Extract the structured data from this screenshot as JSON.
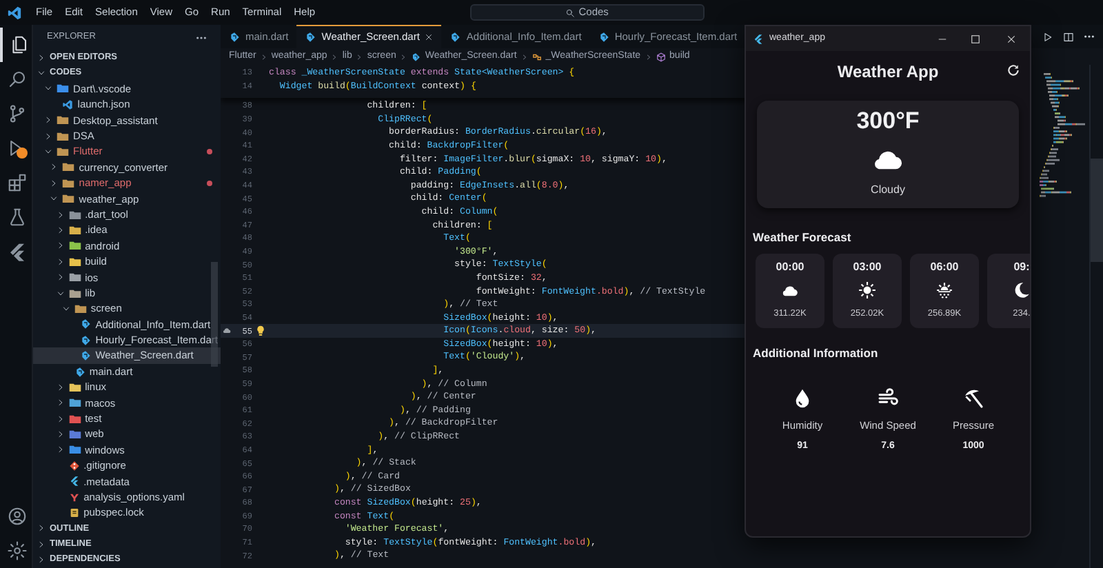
{
  "title_bar": {
    "menus": [
      "File",
      "Edit",
      "Selection",
      "View",
      "Go",
      "Run",
      "Terminal",
      "Help"
    ],
    "search": "Codes"
  },
  "sidebar": {
    "title": "EXPLORER",
    "sections": [
      {
        "title": "OPEN EDITORS",
        "expanded": false
      },
      {
        "title": "CODES",
        "expanded": true,
        "items": [
          {
            "label": "Dart\\.vscode",
            "kind": "folder",
            "color": "#3b8eea",
            "expanded": true,
            "selected": false,
            "modified": false,
            "children": [
              {
                "label": "launch.json",
                "kind": "json",
                "selected": false,
                "modified": false
              }
            ]
          },
          {
            "label": "Desktop_assistant",
            "kind": "folder",
            "color": "#c09553",
            "expanded": false,
            "selected": false,
            "modified": false
          },
          {
            "label": "DSA",
            "kind": "folder",
            "color": "#c09553",
            "expanded": false,
            "selected": false,
            "modified": false
          },
          {
            "label": "Flutter",
            "kind": "folder",
            "color": "#c09553",
            "expanded": true,
            "selected": false,
            "modified": true,
            "children": [
              {
                "label": "currency_converter",
                "kind": "folder",
                "color": "#c09553",
                "expanded": false,
                "selected": false,
                "modified": false
              },
              {
                "label": "namer_app",
                "kind": "folder",
                "color": "#c09553",
                "expanded": false,
                "selected": false,
                "modified": true
              },
              {
                "label": "weather_app",
                "kind": "folder",
                "color": "#c09553",
                "expanded": true,
                "selected": false,
                "modified": false,
                "children": [
                  {
                    "label": ".dart_tool",
                    "kind": "folder",
                    "color": "#8a9199",
                    "expanded": false,
                    "selected": false,
                    "modified": false
                  },
                  {
                    "label": ".idea",
                    "kind": "folder",
                    "color": "#d8b04a",
                    "expanded": false,
                    "selected": false,
                    "modified": false
                  },
                  {
                    "label": "android",
                    "kind": "folder",
                    "color": "#8bc34a",
                    "expanded": false,
                    "selected": false,
                    "modified": false
                  },
                  {
                    "label": "build",
                    "kind": "folder",
                    "color": "#e6c04a",
                    "expanded": false,
                    "selected": false,
                    "modified": false
                  },
                  {
                    "label": "ios",
                    "kind": "folder",
                    "color": "#9aa0a6",
                    "expanded": false,
                    "selected": false,
                    "modified": false
                  },
                  {
                    "label": "lib",
                    "kind": "folder",
                    "color": "#a9a090",
                    "expanded": true,
                    "selected": false,
                    "modified": false,
                    "children": [
                      {
                        "label": "screen",
                        "kind": "folder",
                        "color": "#c09553",
                        "expanded": true,
                        "selected": false,
                        "modified": false,
                        "children": [
                          {
                            "label": "Additional_Info_Item.dart",
                            "kind": "dart",
                            "selected": false,
                            "modified": false
                          },
                          {
                            "label": "Hourly_Forecast_Item.dart",
                            "kind": "dart",
                            "selected": false,
                            "modified": false
                          },
                          {
                            "label": "Weather_Screen.dart",
                            "kind": "dart",
                            "selected": true,
                            "modified": false
                          }
                        ]
                      },
                      {
                        "label": "main.dart",
                        "kind": "dart",
                        "selected": false,
                        "modified": false
                      }
                    ]
                  },
                  {
                    "label": "linux",
                    "kind": "folder",
                    "color": "#e5c35a",
                    "expanded": false,
                    "selected": false,
                    "modified": false
                  },
                  {
                    "label": "macos",
                    "kind": "folder",
                    "color": "#4fa3d8",
                    "expanded": false,
                    "selected": false,
                    "modified": false
                  },
                  {
                    "label": "test",
                    "kind": "folder",
                    "color": "#e05252",
                    "expanded": false,
                    "selected": false,
                    "modified": false
                  },
                  {
                    "label": "web",
                    "kind": "folder",
                    "color": "#5b7bd6",
                    "expanded": false,
                    "selected": false,
                    "modified": false
                  },
                  {
                    "label": "windows",
                    "kind": "folder",
                    "color": "#3a8ee6",
                    "expanded": false,
                    "selected": false,
                    "modified": false
                  },
                  {
                    "label": ".gitignore",
                    "kind": "git",
                    "selected": false,
                    "modified": false
                  },
                  {
                    "label": ".metadata",
                    "kind": "meta",
                    "selected": false,
                    "modified": false
                  },
                  {
                    "label": "analysis_options.yaml",
                    "kind": "yaml",
                    "selected": false,
                    "modified": false
                  },
                  {
                    "label": "pubspec.lock",
                    "kind": "lock",
                    "selected": false,
                    "modified": false
                  }
                ]
              }
            ]
          }
        ]
      },
      {
        "title": "OUTLINE",
        "expanded": false
      },
      {
        "title": "TIMELINE",
        "expanded": false
      },
      {
        "title": "DEPENDENCIES",
        "expanded": false
      }
    ]
  },
  "editor": {
    "tabs": [
      {
        "label": "main.dart",
        "selected": false
      },
      {
        "label": "Weather_Screen.dart",
        "selected": true
      },
      {
        "label": "Additional_Info_Item.dart",
        "selected": false
      },
      {
        "label": "Hourly_Forecast_Item.dart",
        "selected": false
      }
    ],
    "breadcrumb": [
      {
        "text": "Flutter",
        "kind": "plain"
      },
      {
        "text": "weather_app",
        "kind": "plain"
      },
      {
        "text": "lib",
        "kind": "plain"
      },
      {
        "text": "screen",
        "kind": "plain"
      },
      {
        "text": "Weather_Screen.dart",
        "kind": "dart"
      },
      {
        "text": "_WeatherScreenState",
        "kind": "class"
      },
      {
        "text": "build",
        "kind": "method"
      }
    ],
    "sticky_lines": [
      {
        "number": "13",
        "tokens": [
          {
            "kind": "kw",
            "text": "class "
          },
          {
            "kind": "type",
            "text": "_WeatherScreenState "
          },
          {
            "kind": "kw",
            "text": "extends "
          },
          {
            "kind": "type",
            "text": "State<WeatherScreen> "
          },
          {
            "kind": "br",
            "text": "{"
          }
        ]
      },
      {
        "number": "14",
        "tokens": [
          {
            "kind": "type",
            "text": "  Widget "
          },
          {
            "kind": "fn",
            "text": "build"
          },
          {
            "kind": "br",
            "text": "("
          },
          {
            "kind": "type",
            "text": "BuildContext "
          },
          {
            "kind": "p",
            "text": "context"
          },
          {
            "kind": "br",
            "text": ") {"
          }
        ]
      }
    ],
    "lines": [
      {
        "number": "38",
        "current": false,
        "tokens": [
          {
            "kind": "p",
            "text": "                  children: "
          },
          {
            "kind": "br",
            "text": "["
          }
        ]
      },
      {
        "number": "39",
        "current": false,
        "tokens": [
          {
            "kind": "type",
            "text": "                    ClipRRect"
          },
          {
            "kind": "br",
            "text": "("
          }
        ]
      },
      {
        "number": "40",
        "current": false,
        "tokens": [
          {
            "kind": "p",
            "text": "                      borderRadius: "
          },
          {
            "kind": "type",
            "text": "BorderRadius"
          },
          {
            "kind": "p",
            "text": "."
          },
          {
            "kind": "fn",
            "text": "circular"
          },
          {
            "kind": "br",
            "text": "("
          },
          {
            "kind": "num",
            "text": "16"
          },
          {
            "kind": "br",
            "text": ")"
          },
          {
            "kind": "p",
            "text": ","
          }
        ]
      },
      {
        "number": "41",
        "current": false,
        "tokens": [
          {
            "kind": "p",
            "text": "                      child: "
          },
          {
            "kind": "type",
            "text": "BackdropFilter"
          },
          {
            "kind": "br",
            "text": "("
          }
        ]
      },
      {
        "number": "42",
        "current": false,
        "tokens": [
          {
            "kind": "p",
            "text": "                        filter: "
          },
          {
            "kind": "type",
            "text": "ImageFilter"
          },
          {
            "kind": "p",
            "text": "."
          },
          {
            "kind": "fn",
            "text": "blur"
          },
          {
            "kind": "br",
            "text": "("
          },
          {
            "kind": "p",
            "text": "sigmaX: "
          },
          {
            "kind": "num",
            "text": "10"
          },
          {
            "kind": "p",
            "text": ", sigmaY: "
          },
          {
            "kind": "num",
            "text": "10"
          },
          {
            "kind": "br",
            "text": ")"
          },
          {
            "kind": "p",
            "text": ","
          }
        ]
      },
      {
        "number": "43",
        "current": false,
        "tokens": [
          {
            "kind": "p",
            "text": "                        child: "
          },
          {
            "kind": "type",
            "text": "Padding"
          },
          {
            "kind": "br",
            "text": "("
          }
        ]
      },
      {
        "number": "44",
        "current": false,
        "tokens": [
          {
            "kind": "p",
            "text": "                          padding: "
          },
          {
            "kind": "type",
            "text": "EdgeInsets"
          },
          {
            "kind": "p",
            "text": "."
          },
          {
            "kind": "fn",
            "text": "all"
          },
          {
            "kind": "br",
            "text": "("
          },
          {
            "kind": "num",
            "text": "8.0"
          },
          {
            "kind": "br",
            "text": ")"
          },
          {
            "kind": "p",
            "text": ","
          }
        ]
      },
      {
        "number": "45",
        "current": false,
        "tokens": [
          {
            "kind": "p",
            "text": "                          child: "
          },
          {
            "kind": "type",
            "text": "Center"
          },
          {
            "kind": "br",
            "text": "("
          }
        ]
      },
      {
        "number": "46",
        "current": false,
        "tokens": [
          {
            "kind": "p",
            "text": "                            child: "
          },
          {
            "kind": "type",
            "text": "Column"
          },
          {
            "kind": "br",
            "text": "("
          }
        ]
      },
      {
        "number": "47",
        "current": false,
        "tokens": [
          {
            "kind": "p",
            "text": "                              children: "
          },
          {
            "kind": "br",
            "text": "["
          }
        ]
      },
      {
        "number": "48",
        "current": false,
        "tokens": [
          {
            "kind": "type",
            "text": "                                Text"
          },
          {
            "kind": "br",
            "text": "("
          }
        ]
      },
      {
        "number": "49",
        "current": false,
        "tokens": [
          {
            "kind": "str",
            "text": "                                  '300°F'"
          },
          {
            "kind": "p",
            "text": ","
          }
        ]
      },
      {
        "number": "50",
        "current": false,
        "tokens": [
          {
            "kind": "p",
            "text": "                                  style: "
          },
          {
            "kind": "type",
            "text": "TextStyle"
          },
          {
            "kind": "br",
            "text": "("
          }
        ]
      },
      {
        "number": "51",
        "current": false,
        "tokens": [
          {
            "kind": "p",
            "text": "                                      fontSize: "
          },
          {
            "kind": "num",
            "text": "32"
          },
          {
            "kind": "p",
            "text": ","
          }
        ]
      },
      {
        "number": "52",
        "current": false,
        "tokens": [
          {
            "kind": "p",
            "text": "                                      fontWeight: "
          },
          {
            "kind": "type",
            "text": "FontWeight"
          },
          {
            "kind": "num",
            "text": ".bold"
          },
          {
            "kind": "br",
            "text": ")"
          },
          {
            "kind": "p",
            "text": ", "
          },
          {
            "kind": "com",
            "text": "// TextStyle"
          }
        ]
      },
      {
        "number": "53",
        "current": false,
        "tokens": [
          {
            "kind": "br",
            "text": "                                )"
          },
          {
            "kind": "p",
            "text": ", "
          },
          {
            "kind": "com",
            "text": "// Text"
          }
        ]
      },
      {
        "number": "54",
        "current": false,
        "tokens": [
          {
            "kind": "type",
            "text": "                                SizedBox"
          },
          {
            "kind": "br",
            "text": "("
          },
          {
            "kind": "p",
            "text": "height: "
          },
          {
            "kind": "num",
            "text": "10"
          },
          {
            "kind": "br",
            "text": ")"
          },
          {
            "kind": "p",
            "text": ","
          }
        ]
      },
      {
        "number": "55",
        "current": true,
        "tokens": [
          {
            "kind": "type",
            "text": "                                Icon"
          },
          {
            "kind": "br",
            "text": "("
          },
          {
            "kind": "type",
            "text": "Icons"
          },
          {
            "kind": "p",
            "text": "."
          },
          {
            "kind": "num",
            "text": "cloud"
          },
          {
            "kind": "p",
            "text": ", size: "
          },
          {
            "kind": "num",
            "text": "50"
          },
          {
            "kind": "br",
            "text": ")"
          },
          {
            "kind": "p",
            "text": ","
          }
        ]
      },
      {
        "number": "56",
        "current": false,
        "tokens": [
          {
            "kind": "type",
            "text": "                                SizedBox"
          },
          {
            "kind": "br",
            "text": "("
          },
          {
            "kind": "p",
            "text": "height: "
          },
          {
            "kind": "num",
            "text": "10"
          },
          {
            "kind": "br",
            "text": ")"
          },
          {
            "kind": "p",
            "text": ","
          }
        ]
      },
      {
        "number": "57",
        "current": false,
        "tokens": [
          {
            "kind": "type",
            "text": "                                Text"
          },
          {
            "kind": "br",
            "text": "("
          },
          {
            "kind": "str",
            "text": "'Cloudy'"
          },
          {
            "kind": "br",
            "text": ")"
          },
          {
            "kind": "p",
            "text": ","
          }
        ]
      },
      {
        "number": "58",
        "current": false,
        "tokens": [
          {
            "kind": "br",
            "text": "                              ]"
          },
          {
            "kind": "p",
            "text": ","
          }
        ]
      },
      {
        "number": "59",
        "current": false,
        "tokens": [
          {
            "kind": "br",
            "text": "                            )"
          },
          {
            "kind": "p",
            "text": ", "
          },
          {
            "kind": "com",
            "text": "// Column"
          }
        ]
      },
      {
        "number": "60",
        "current": false,
        "tokens": [
          {
            "kind": "br",
            "text": "                          )"
          },
          {
            "kind": "p",
            "text": ", "
          },
          {
            "kind": "com",
            "text": "// Center"
          }
        ]
      },
      {
        "number": "61",
        "current": false,
        "tokens": [
          {
            "kind": "br",
            "text": "                        )"
          },
          {
            "kind": "p",
            "text": ", "
          },
          {
            "kind": "com",
            "text": "// Padding"
          }
        ]
      },
      {
        "number": "62",
        "current": false,
        "tokens": [
          {
            "kind": "br",
            "text": "                      )"
          },
          {
            "kind": "p",
            "text": ", "
          },
          {
            "kind": "com",
            "text": "// BackdropFilter"
          }
        ]
      },
      {
        "number": "63",
        "current": false,
        "tokens": [
          {
            "kind": "br",
            "text": "                    )"
          },
          {
            "kind": "p",
            "text": ", "
          },
          {
            "kind": "com",
            "text": "// ClipRRect"
          }
        ]
      },
      {
        "number": "64",
        "current": false,
        "tokens": [
          {
            "kind": "br",
            "text": "                  ]"
          },
          {
            "kind": "p",
            "text": ","
          }
        ]
      },
      {
        "number": "65",
        "current": false,
        "tokens": [
          {
            "kind": "br",
            "text": "                )"
          },
          {
            "kind": "p",
            "text": ", "
          },
          {
            "kind": "com",
            "text": "// Stack"
          }
        ]
      },
      {
        "number": "66",
        "current": false,
        "tokens": [
          {
            "kind": "br",
            "text": "              )"
          },
          {
            "kind": "p",
            "text": ", "
          },
          {
            "kind": "com",
            "text": "// Card"
          }
        ]
      },
      {
        "number": "67",
        "current": false,
        "tokens": [
          {
            "kind": "br",
            "text": "            )"
          },
          {
            "kind": "p",
            "text": ", "
          },
          {
            "kind": "com",
            "text": "// SizedBox"
          }
        ]
      },
      {
        "number": "68",
        "current": false,
        "tokens": [
          {
            "kind": "kw",
            "text": "            const "
          },
          {
            "kind": "type",
            "text": "SizedBox"
          },
          {
            "kind": "br",
            "text": "("
          },
          {
            "kind": "p",
            "text": "height: "
          },
          {
            "kind": "num",
            "text": "25"
          },
          {
            "kind": "br",
            "text": ")"
          },
          {
            "kind": "p",
            "text": ","
          }
        ]
      },
      {
        "number": "69",
        "current": false,
        "tokens": [
          {
            "kind": "kw",
            "text": "            const "
          },
          {
            "kind": "type",
            "text": "Text"
          },
          {
            "kind": "br",
            "text": "("
          }
        ]
      },
      {
        "number": "70",
        "current": false,
        "tokens": [
          {
            "kind": "str",
            "text": "              'Weather Forecast'"
          },
          {
            "kind": "p",
            "text": ","
          }
        ]
      },
      {
        "number": "71",
        "current": false,
        "tokens": [
          {
            "kind": "p",
            "text": "              style: "
          },
          {
            "kind": "type",
            "text": "TextStyle"
          },
          {
            "kind": "br",
            "text": "("
          },
          {
            "kind": "p",
            "text": "fontWeight: "
          },
          {
            "kind": "type",
            "text": "FontWeight"
          },
          {
            "kind": "num",
            "text": ".bold"
          },
          {
            "kind": "br",
            "text": ")"
          },
          {
            "kind": "p",
            "text": ","
          }
        ]
      },
      {
        "number": "72",
        "current": false,
        "tokens": [
          {
            "kind": "br",
            "text": "            )"
          },
          {
            "kind": "p",
            "text": ", "
          },
          {
            "kind": "com",
            "text": "// Text"
          }
        ]
      }
    ]
  },
  "app": {
    "window_title": "weather_app",
    "title": "Weather App",
    "current": {
      "temperature": "300°F",
      "kind": "cloud",
      "condition": "Cloudy"
    },
    "forecast_heading": "Weather Forecast",
    "forecast": [
      {
        "time": "00:00",
        "kind": "cloud",
        "value": "311.22K"
      },
      {
        "time": "03:00",
        "kind": "sun",
        "value": "252.02K"
      },
      {
        "time": "06:00",
        "kind": "sun_rain",
        "value": "256.89K"
      },
      {
        "time": "09:",
        "kind": "moon",
        "value": "234."
      }
    ],
    "info_heading": "Additional Information",
    "info": [
      {
        "kind": "drop",
        "label": "Humidity",
        "value": "91"
      },
      {
        "kind": "wind",
        "label": "Wind Speed",
        "value": "7.6"
      },
      {
        "kind": "umbrella",
        "label": "Pressure",
        "value": "1000"
      }
    ]
  }
}
